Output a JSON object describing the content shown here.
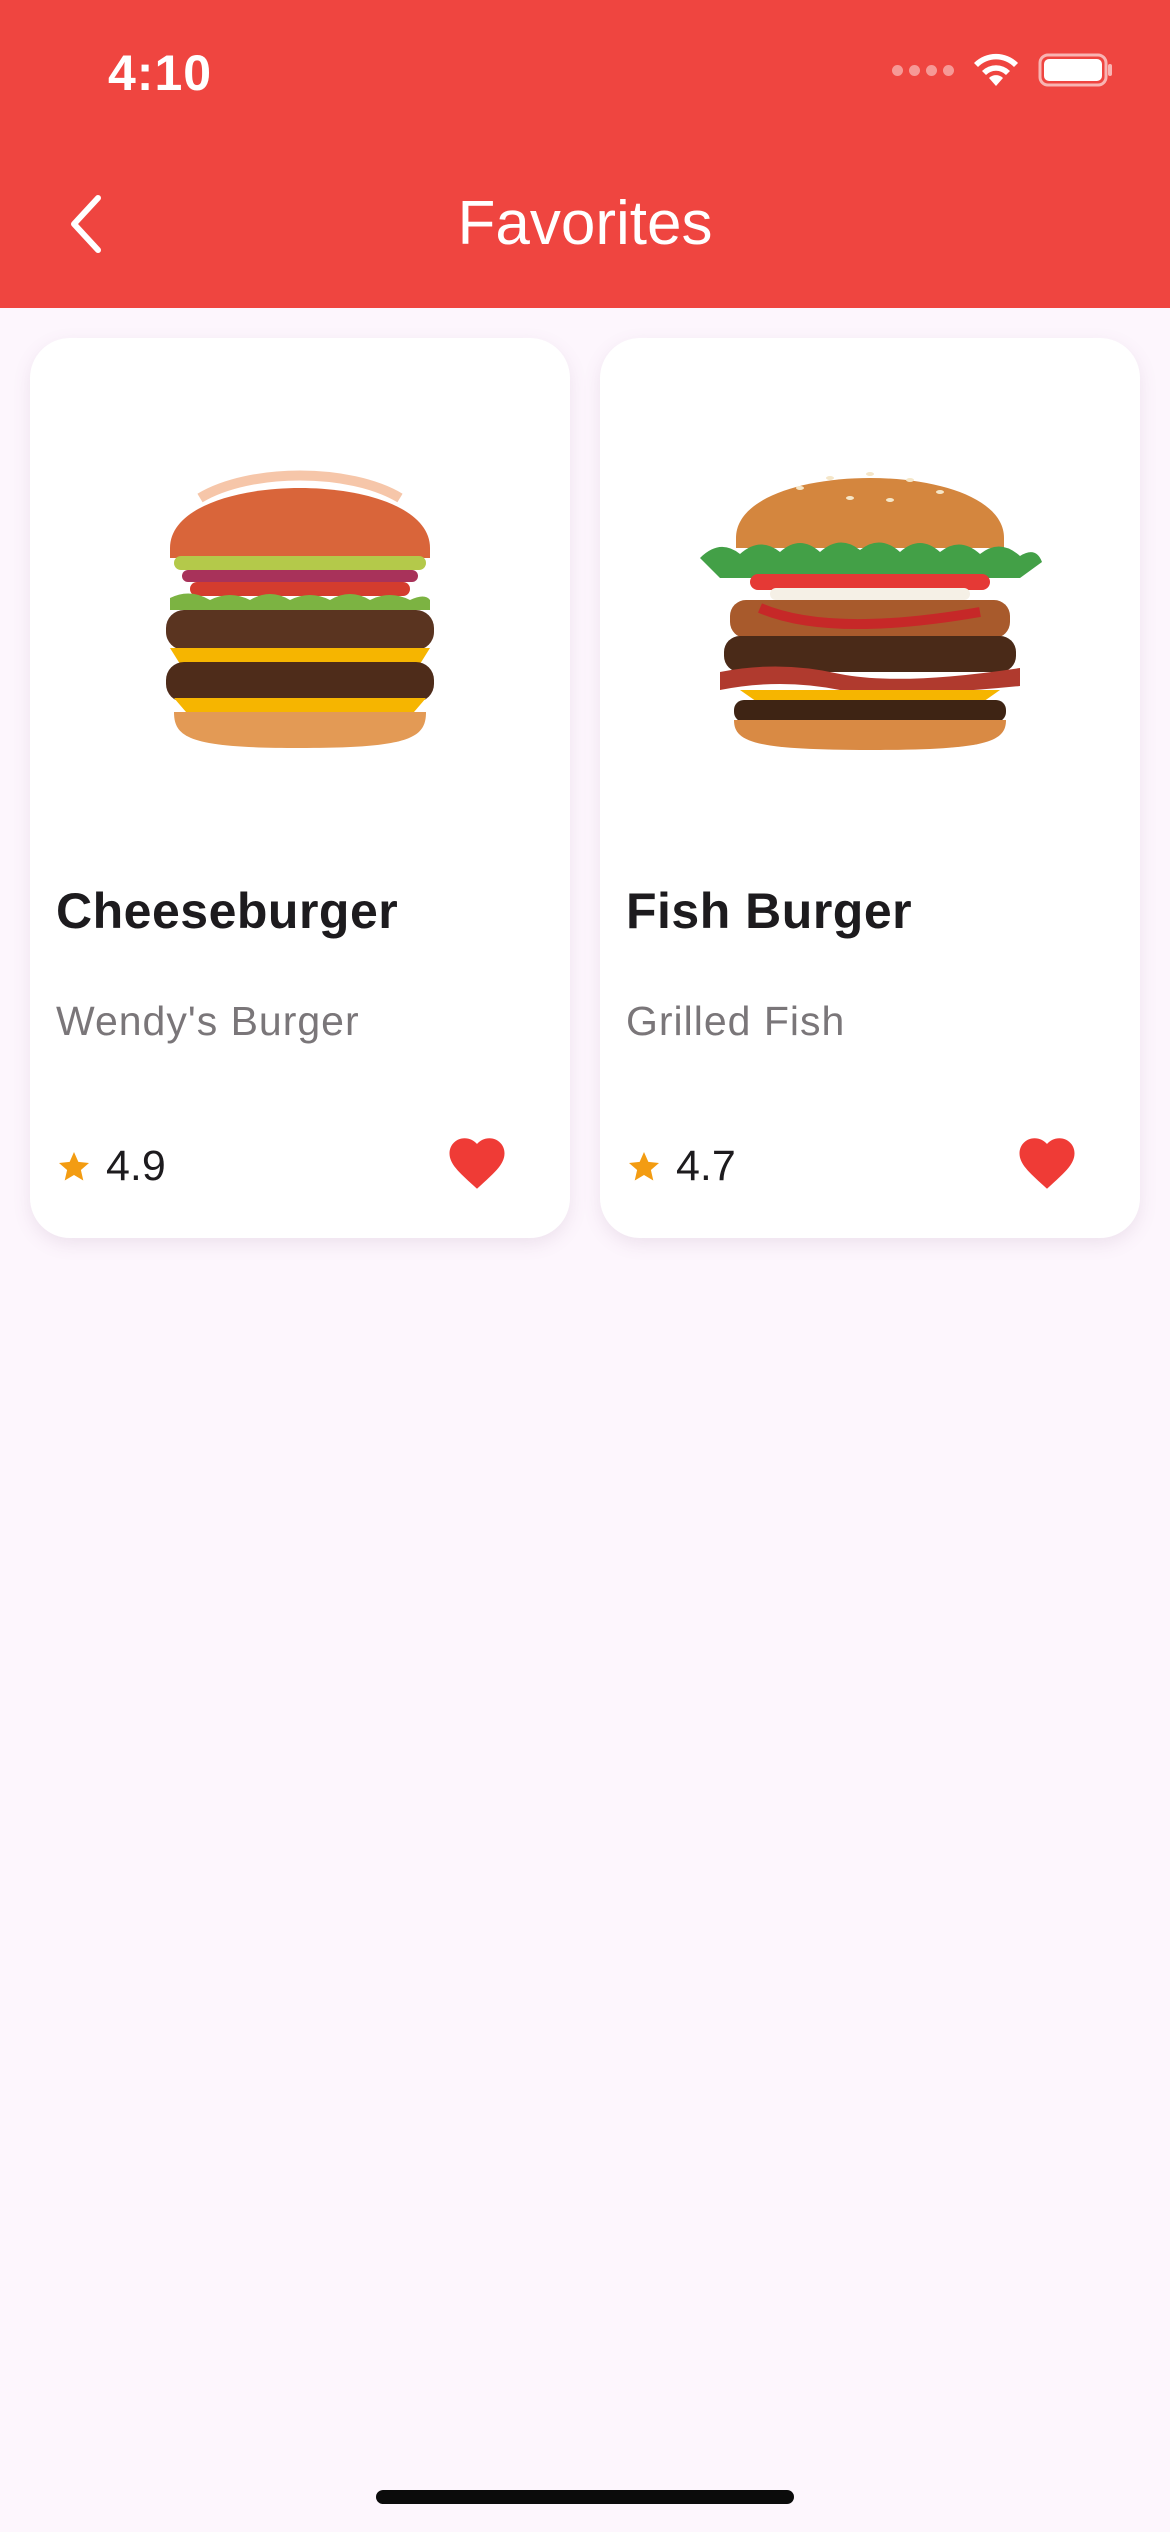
{
  "status_bar": {
    "time": "4:10"
  },
  "app_bar": {
    "title": "Favorites",
    "back_icon": "chevron-left-icon",
    "background_color": "#ef4540"
  },
  "favorites": [
    {
      "name": "Cheeseburger",
      "subtitle": "Wendy's Burger",
      "rating": "4.9",
      "image": "cheeseburger-image",
      "favorited": true
    },
    {
      "name": "Fish Burger",
      "subtitle": "Grilled Fish",
      "rating": "4.7",
      "image": "fish-burger-image",
      "favorited": true
    }
  ],
  "colors": {
    "accent": "#ef4540",
    "star": "#f39c12",
    "heart": "#ef3b36",
    "background": "#fdf6fd"
  }
}
